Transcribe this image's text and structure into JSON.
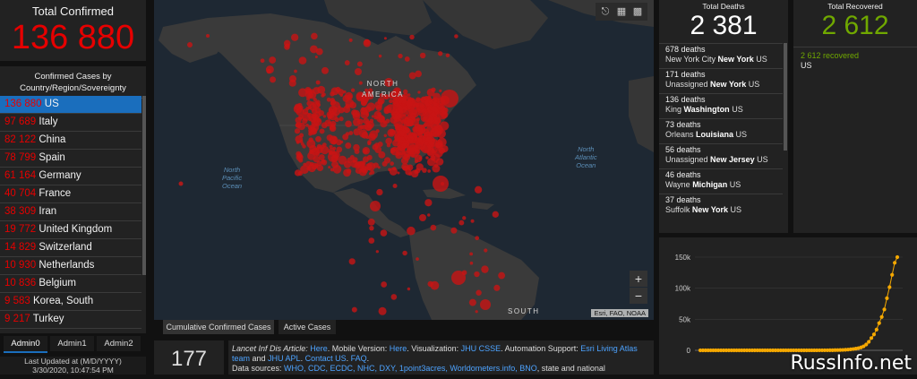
{
  "total_confirmed": {
    "label": "Total Confirmed",
    "value": "136 880"
  },
  "country_panel": {
    "header": "Confirmed Cases by Country/Region/Sovereignty",
    "items": [
      {
        "count": "136 880",
        "name": "US",
        "selected": true
      },
      {
        "count": "97 689",
        "name": "Italy"
      },
      {
        "count": "82 122",
        "name": "China"
      },
      {
        "count": "78 799",
        "name": "Spain"
      },
      {
        "count": "61 164",
        "name": "Germany"
      },
      {
        "count": "40 704",
        "name": "France"
      },
      {
        "count": "38 309",
        "name": "Iran"
      },
      {
        "count": "19 772",
        "name": "United Kingdom"
      },
      {
        "count": "14 829",
        "name": "Switzerland"
      },
      {
        "count": "10 930",
        "name": "Netherlands"
      },
      {
        "count": "10 836",
        "name": "Belgium"
      },
      {
        "count": "9 583",
        "name": "Korea, South"
      },
      {
        "count": "9 217",
        "name": "Turkey"
      }
    ]
  },
  "admin_tabs": [
    "Admin0",
    "Admin1",
    "Admin2"
  ],
  "last_updated": {
    "label": "Last Updated at (M/D/YYYY)",
    "value": "3/30/2020, 10:47:54 PM"
  },
  "map": {
    "labels": {
      "north_america": "NORTH\nAMERICA",
      "south": "SOUTH"
    },
    "oceans": {
      "pacific": "North\nPacific\nOcean",
      "atlantic": "North\nAtlantic\nOcean"
    },
    "attribution": "Esri, FAO, NOAA",
    "zoom_in": "+",
    "zoom_out": "−",
    "tool_icons": [
      "bookmark-icon",
      "grid-icon",
      "basemap-icon"
    ]
  },
  "map_tabs": [
    "Cumulative Confirmed Cases",
    "Active Cases"
  ],
  "country_count": "177",
  "info": {
    "line1_prefix": "Lancet Inf Dis Article: ",
    "line1_here1": "Here",
    "line1_mobile": ". Mobile Version: ",
    "line1_here2": "Here",
    "line1_viz": ". Visualization: ",
    "line1_jhu": "JHU CSSE",
    "line1_auto": ". Automation Support: ",
    "line1_esri": "Esri Living Atlas team",
    "line1_and": " and ",
    "line1_apl": "JHU APL",
    "line1_contact": "Contact US",
    "line1_faq": "FAQ",
    "line2_prefix": "Data sources: ",
    "line2_sources": "WHO, CDC, ECDC, NHC, DXY, 1point3acres, Worldometers.info, BNO",
    "line2_suffix": ", state and national"
  },
  "deaths": {
    "label": "Total Deaths",
    "value": "2 381",
    "items": [
      {
        "count": "678 deaths",
        "place": "New York City",
        "state": "New York",
        "country": "US"
      },
      {
        "count": "171 deaths",
        "place": "Unassigned",
        "state": "New York",
        "country": "US"
      },
      {
        "count": "136 deaths",
        "place": "King",
        "state": "Washington",
        "country": "US"
      },
      {
        "count": "73 deaths",
        "place": "Orleans",
        "state": "Louisiana",
        "country": "US"
      },
      {
        "count": "56 deaths",
        "place": "Unassigned",
        "state": "New Jersey",
        "country": "US"
      },
      {
        "count": "46 deaths",
        "place": "Wayne",
        "state": "Michigan",
        "country": "US"
      },
      {
        "count": "37 deaths",
        "place": "Suffolk",
        "state": "New York",
        "country": "US"
      }
    ]
  },
  "recovered": {
    "label": "Total Recovered",
    "value": "2 612",
    "items": [
      {
        "count": "2 612 recovered",
        "country": "US"
      }
    ]
  },
  "chart_data": {
    "type": "line",
    "ylim": [
      0,
      150000
    ],
    "yticks": [
      "150k",
      "100k",
      "50k",
      "0"
    ],
    "ytick_values": [
      150000,
      100000,
      50000,
      0
    ],
    "values": [
      1,
      1,
      2,
      2,
      5,
      5,
      5,
      5,
      5,
      6,
      6,
      8,
      8,
      11,
      11,
      11,
      12,
      12,
      12,
      12,
      13,
      13,
      14,
      14,
      14,
      14,
      14,
      14,
      14,
      15,
      15,
      15,
      15,
      15,
      15,
      15,
      15,
      15,
      35,
      35,
      35,
      53,
      57,
      60,
      62,
      64,
      69,
      89,
      105,
      125,
      161,
      228,
      311,
      428,
      547,
      653,
      882,
      1162,
      1609,
      2090,
      2747,
      3508,
      4700,
      6434,
      9340,
      13654,
      19774,
      25600,
      33301,
      43794,
      53764,
      65843,
      83836,
      101657,
      121465,
      140909,
      161831
    ],
    "color": "#f5a800"
  },
  "watermark": "RussInfo.net"
}
